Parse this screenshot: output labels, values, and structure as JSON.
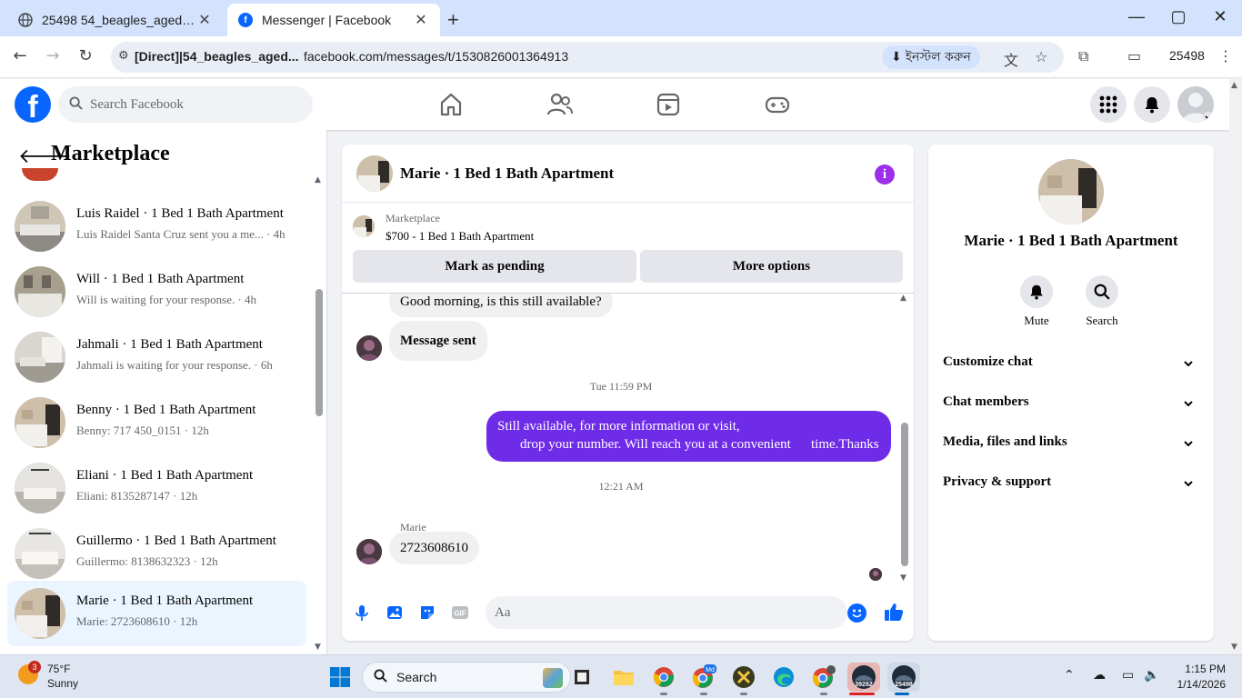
{
  "browser": {
    "tabs": [
      {
        "title": "25498 54_beagles_aged@i",
        "close": "✕"
      },
      {
        "title": "Messenger | Facebook",
        "close": "✕"
      }
    ],
    "new_tab": "+",
    "window_controls": [
      "—",
      "▢",
      "✕"
    ],
    "site_label": "[Direct]|54_beagles_aged...",
    "url": "facebook.com/messages/t/1530826001364913",
    "install_label": "ইনস্টল করুন",
    "profile_label": "25498"
  },
  "fb": {
    "logo": "f",
    "search_placeholder": "Search Facebook"
  },
  "sidebar": {
    "title": "Marketplace",
    "conversations": [
      {
        "name": "Luis Raidel · 1 Bed 1 Bath Apartment",
        "preview": "Luis Raidel Santa Cruz sent you a me... · 4h"
      },
      {
        "name": "Will · 1 Bed 1 Bath Apartment",
        "preview": "Will is waiting for your response. · 4h"
      },
      {
        "name": "Jahmali · 1 Bed 1 Bath Apartment",
        "preview": "Jahmali is waiting for your response. · 6h"
      },
      {
        "name": "Benny · 1 Bed 1 Bath Apartment",
        "preview": "Benny: 717 450_0151 · 12h"
      },
      {
        "name": "Eliani · 1 Bed 1 Bath Apartment",
        "preview": "Eliani: 8135287147 · 12h"
      },
      {
        "name": "Guillermo · 1 Bed 1 Bath Apartment",
        "preview": "Guillermo: 8138632323 · 12h"
      },
      {
        "name": "Marie · 1 Bed 1 Bath Apartment",
        "preview": "Marie: 2723608610 · 12h"
      }
    ]
  },
  "chat": {
    "title": "Marie · 1 Bed 1 Bath Apartment",
    "info_glyph": "i",
    "marketplace_label": "Marketplace",
    "listing": "$700 - 1 Bed 1 Bath Apartment",
    "mark_pending": "Mark as pending",
    "more_options": "More options",
    "messages": {
      "greeting": "Good morning, is this still available?",
      "sent_notice": "Message sent",
      "time1": "Tue 11:59 PM",
      "reply_line1": "Still available, for more information or visit,",
      "reply_line2": "drop your number. Will reach you at a convenient",
      "reply_line3": "time.Thanks",
      "time2": "12:21 AM",
      "sender": "Marie",
      "number": "2723608610"
    },
    "input_placeholder": "Aa"
  },
  "info_panel": {
    "title": "Marie · 1 Bed 1 Bath Apartment",
    "mute": "Mute",
    "search": "Search",
    "sections": [
      "Customize chat",
      "Chat members",
      "Media, files and links",
      "Privacy & support"
    ]
  },
  "taskbar": {
    "weather_badge": "3",
    "temperature": "75°F",
    "condition": "Sunny",
    "search": "Search",
    "app_badge_1": "39262",
    "app_badge_2": "25498",
    "time": "1:15 PM",
    "date": "1/14/2026"
  },
  "colors": {
    "fb_blue": "#0866ff",
    "sent_bubble": "#6e2be8",
    "info_purple": "#9b2fea",
    "active_conversation": "#ebf5ff"
  }
}
